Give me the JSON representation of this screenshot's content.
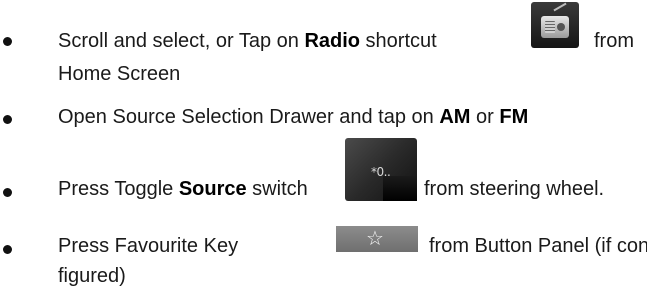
{
  "items": [
    {
      "part1": "Scroll and select, or Tap on ",
      "bold1": "Radio",
      "part2": " shortcut",
      "part3": "from",
      "line2": "Home Screen",
      "icon": "radio-shortcut-icon"
    },
    {
      "part1": "Open Source Selection Drawer and tap on ",
      "bold1": "AM",
      "part2": " or ",
      "bold2": "FM"
    },
    {
      "part1": "Press Toggle ",
      "bold1": "Source",
      "part2": " switch",
      "part3": "from steering wheel.",
      "icon": "source-switch-icon",
      "icon_label": "*0.."
    },
    {
      "part1": "Press Favourite Key",
      "part2": "from Button Panel (if con-",
      "line2": "figured)",
      "icon": "favourite-star-icon",
      "icon_glyph": "☆"
    }
  ]
}
